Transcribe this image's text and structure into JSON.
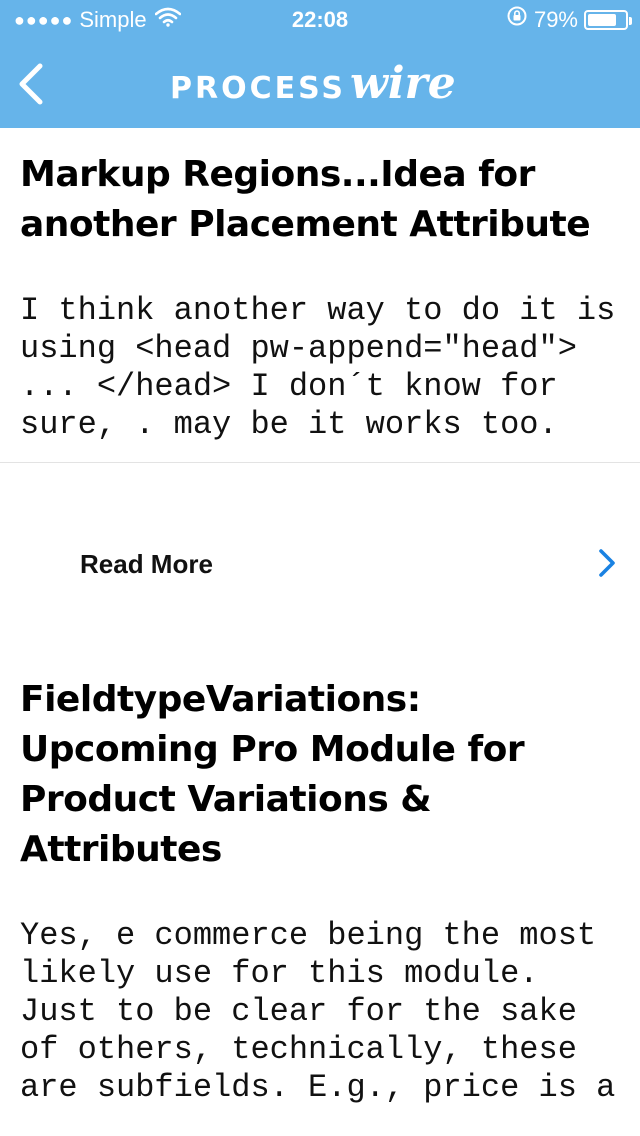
{
  "status_bar": {
    "signal": "●●●●●",
    "carrier": "Simple",
    "time": "22:08",
    "battery_percent_text": "79%",
    "battery_level": 0.79
  },
  "nav": {
    "logo_process": "PROCESS",
    "logo_wire": "wire"
  },
  "posts": [
    {
      "title": "Markup Regions...Idea for another Placement Attribute",
      "excerpt": "I think another way to do it is using <head pw-append=\"head\"> ... </head> I don´t know for sure, . may be it works too.",
      "read_more": "Read More"
    },
    {
      "title": "FieldtypeVariations: Upcoming Pro Module for Product Variations & Attributes",
      "excerpt": "Yes, e commerce being the most likely use for this module. Just to be clear for the sake of others, technically, these are subfields. E.g., price is a"
    }
  ],
  "colors": {
    "header_bg": "#66b4ea",
    "accent": "#1a82e2"
  },
  "icons": {
    "back": "chevron-left-icon",
    "wifi": "wifi-icon",
    "rotation_lock": "rotation-lock-icon",
    "battery": "battery-icon",
    "read_more": "chevron-right-icon"
  }
}
